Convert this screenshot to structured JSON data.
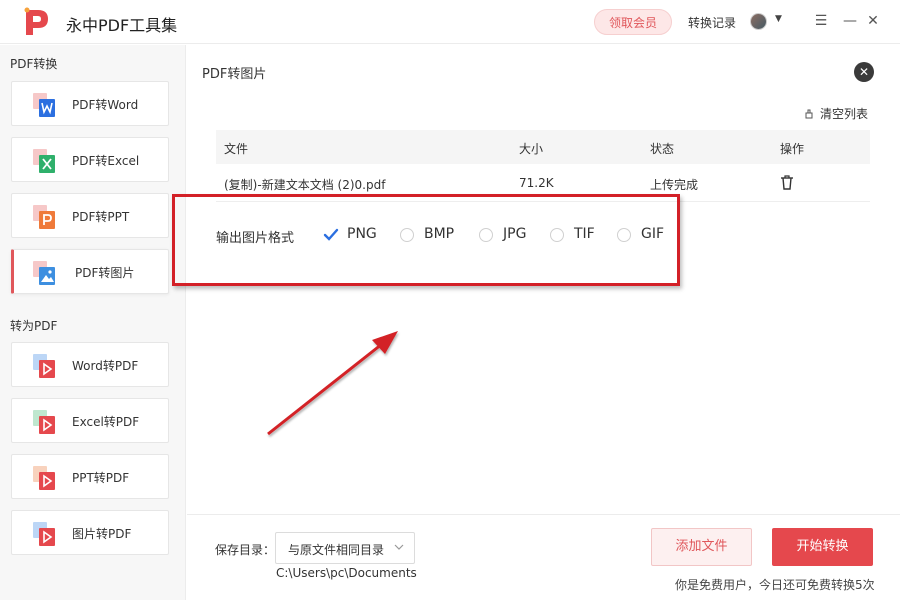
{
  "app": {
    "title": "永中PDF工具集"
  },
  "header": {
    "vip_label": "领取会员",
    "history_label": "转换记录",
    "minimize_icon": "menu-icon",
    "win_controls": [
      "☰",
      "—",
      "✕"
    ]
  },
  "sidebar": {
    "section1_title": "PDF转换",
    "section1_items": [
      {
        "label": "PDF转Word",
        "icon": "word-icon",
        "color": "#2b6fe0"
      },
      {
        "label": "PDF转Excel",
        "icon": "excel-icon",
        "color": "#2fb06b"
      },
      {
        "label": "PDF转PPT",
        "icon": "ppt-icon",
        "color": "#ef7a3a"
      },
      {
        "label": "PDF转图片",
        "icon": "image-icon",
        "color": "#3d8fe0"
      }
    ],
    "section2_title": "转为PDF",
    "section2_items": [
      {
        "label": "Word转PDF",
        "icon": "word-to-pdf-icon",
        "color": "#e5484d"
      },
      {
        "label": "Excel转PDF",
        "icon": "excel-to-pdf-icon",
        "color": "#e5484d"
      },
      {
        "label": "PPT转PDF",
        "icon": "ppt-to-pdf-icon",
        "color": "#e5484d"
      },
      {
        "label": "图片转PDF",
        "icon": "image-to-pdf-icon",
        "color": "#e5484d"
      }
    ],
    "active_index": 3
  },
  "main": {
    "title": "PDF转图片",
    "clear_list": "清空列表",
    "columns": [
      "文件",
      "大小",
      "状态",
      "操作"
    ],
    "rows": [
      {
        "file": "(复制)-新建文本文档 (2)0.pdf",
        "size": "71.2K",
        "status": "上传完成"
      }
    ],
    "format_label": "输出图片格式",
    "formats": [
      "PNG",
      "BMP",
      "JPG",
      "TIF",
      "GIF"
    ],
    "selected_format": "PNG"
  },
  "footer": {
    "save_label": "保存目录：",
    "save_option": "与原文件相同目录",
    "save_path": "C:\\Users\\pc\\Documents",
    "add_button": "添加文件",
    "start_button": "开始转换",
    "free_note": "你是免费用户，今日还可免费转换5次"
  },
  "colors": {
    "accent": "#e5484d",
    "highlight": "#d32027"
  }
}
